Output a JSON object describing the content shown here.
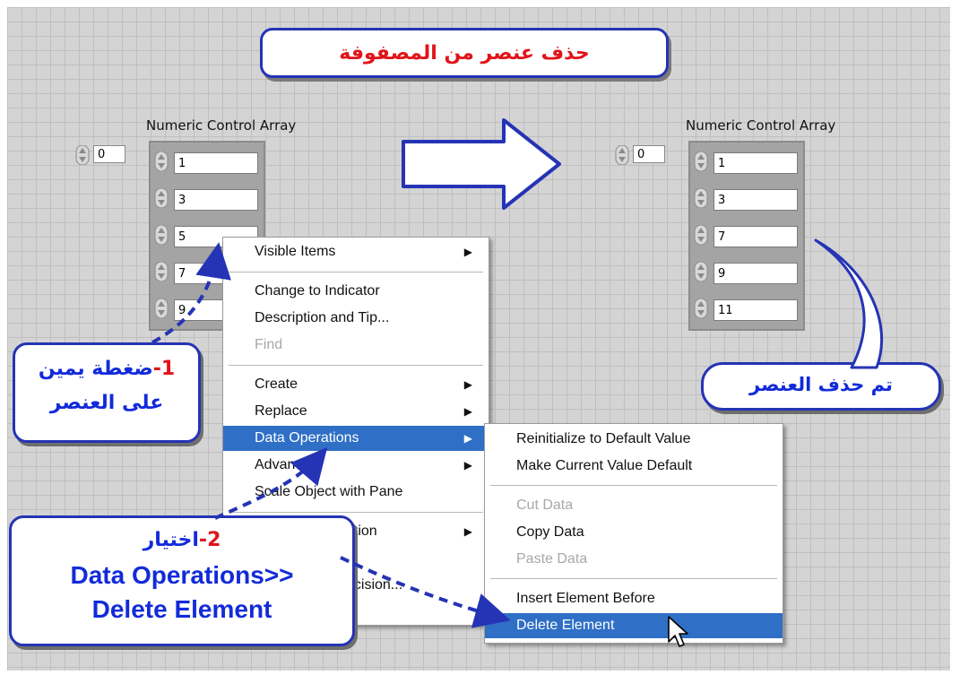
{
  "title": "حذف عنصر من المصفوفة",
  "left_array": {
    "label": "Numeric Control Array",
    "index": "0",
    "values": [
      "1",
      "3",
      "5",
      "7",
      "9"
    ]
  },
  "right_array": {
    "label": "Numeric Control Array",
    "index": "0",
    "values": [
      "1",
      "3",
      "7",
      "9",
      "11"
    ]
  },
  "context_menu": {
    "items": [
      {
        "label": "Visible Items",
        "submenu": true,
        "disabled": false
      },
      {
        "label": "Change to Indicator",
        "submenu": false,
        "disabled": false
      },
      {
        "label": "Description and Tip...",
        "submenu": false,
        "disabled": false
      },
      {
        "label": "Find",
        "submenu": false,
        "disabled": true
      },
      {
        "label": "Create",
        "submenu": true,
        "disabled": false
      },
      {
        "label": "Replace",
        "submenu": true,
        "disabled": false
      },
      {
        "label": "Data Operations",
        "submenu": true,
        "disabled": false,
        "selected": true
      },
      {
        "label": "Advanced",
        "submenu": true,
        "disabled": false
      },
      {
        "label": "Scale Object with Pane",
        "submenu": false,
        "disabled": false
      },
      {
        "label": "ation",
        "submenu": true,
        "disabled": false
      },
      {
        "label": "ecision...",
        "submenu": false,
        "disabled": false
      }
    ]
  },
  "submenu": {
    "items": [
      {
        "label": "Reinitialize to Default Value",
        "disabled": false
      },
      {
        "label": "Make Current Value Default",
        "disabled": false
      },
      {
        "label": "Cut Data",
        "disabled": true
      },
      {
        "label": "Copy Data",
        "disabled": false
      },
      {
        "label": "Paste Data",
        "disabled": true
      },
      {
        "label": "Insert Element Before",
        "disabled": false
      },
      {
        "label": "Delete Element",
        "disabled": false,
        "selected": true
      }
    ]
  },
  "callouts": {
    "step1": {
      "number": "1-",
      "line1": "ضغطة يمين",
      "line2": "على العنصر"
    },
    "step2": {
      "number": "2-",
      "line1": "اختيار",
      "line2": "Data Operations>>",
      "line3": "Delete Element"
    },
    "done": "تم حذف العنصر"
  },
  "colors": {
    "accent": "#2533b5",
    "title_red": "#e0141a",
    "menu_highlight": "#2f6fc6",
    "callout_text": "#122bd9"
  },
  "icons": [
    "spinner-icon",
    "submenu-arrow-icon",
    "big-right-arrow-icon",
    "mouse-cursor-icon"
  ]
}
